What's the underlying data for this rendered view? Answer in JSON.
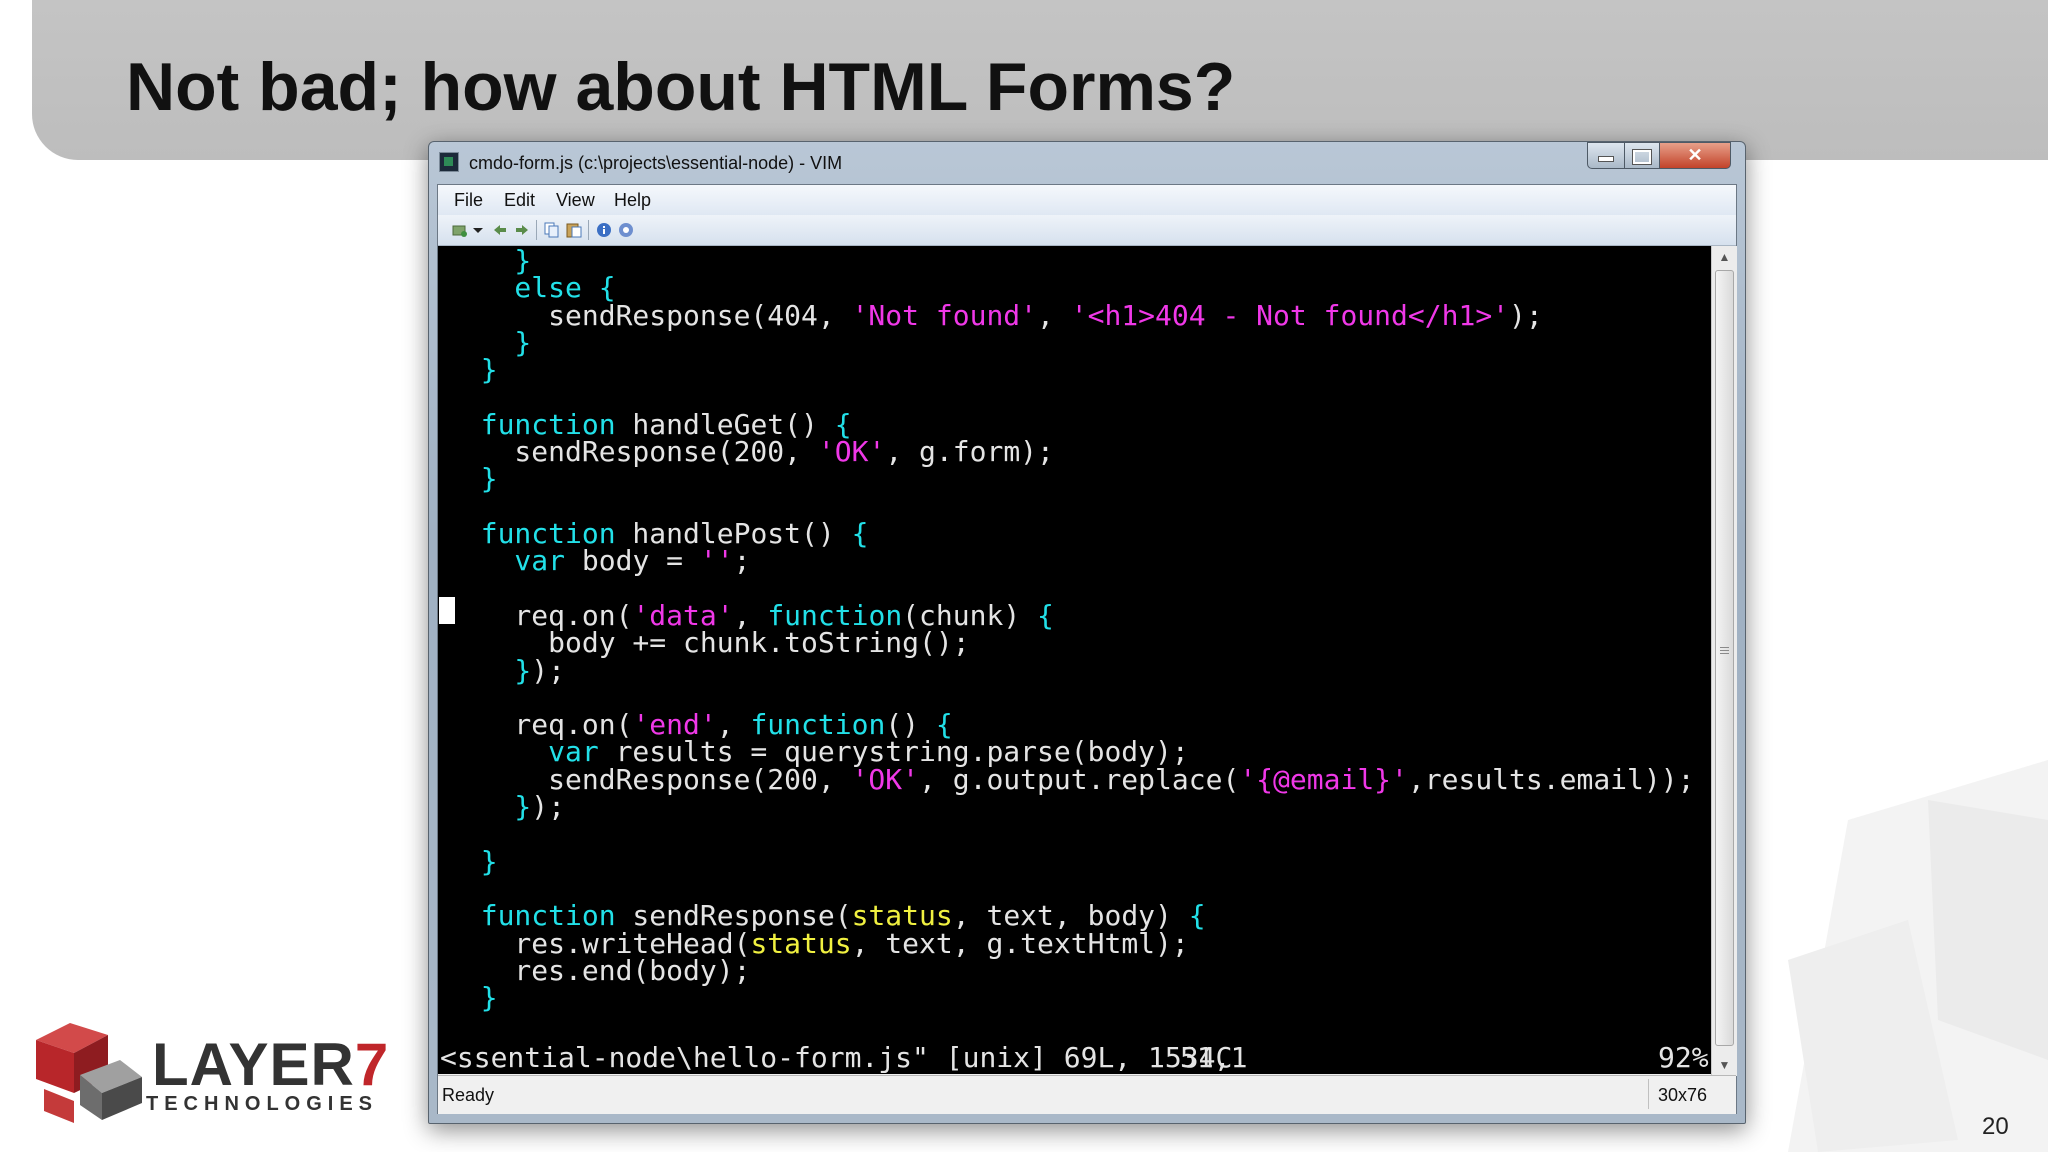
{
  "slide": {
    "title": "Not bad; how about HTML Forms?",
    "page_number": "20",
    "logo_text": "LAYER",
    "logo_number": "7",
    "logo_subtitle": "TECHNOLOGIES"
  },
  "window": {
    "title": "cmdo-form.js (c:\\projects\\essential-node) - VIM",
    "close_glyph": "✕"
  },
  "menu": [
    "File",
    "Edit",
    "View",
    "Help"
  ],
  "toolbar_icons": [
    "open-icon",
    "dropdown-arrow-icon",
    "back-icon",
    "forward-icon",
    "copy-icon",
    "paste-icon",
    "info-icon",
    "help-icon"
  ],
  "code_lines": [
    [
      {
        "c": "br",
        "t": "    }"
      }
    ],
    [
      {
        "c": "k",
        "t": "    else "
      },
      {
        "c": "br",
        "t": "{"
      }
    ],
    [
      {
        "c": "",
        "t": "      sendResponse(404, "
      },
      {
        "c": "s",
        "t": "'Not found'"
      },
      {
        "c": "",
        "t": ", "
      },
      {
        "c": "s",
        "t": "'<h1>404 - Not found</h1>'"
      },
      {
        "c": "",
        "t": ");"
      }
    ],
    [
      {
        "c": "br",
        "t": "    }"
      }
    ],
    [
      {
        "c": "br",
        "t": "  }"
      }
    ],
    [],
    [
      {
        "c": "k",
        "t": "  function"
      },
      {
        "c": "",
        "t": " handleGet() "
      },
      {
        "c": "br",
        "t": "{"
      }
    ],
    [
      {
        "c": "",
        "t": "    sendResponse(200, "
      },
      {
        "c": "s",
        "t": "'OK'"
      },
      {
        "c": "",
        "t": ", g.form);"
      }
    ],
    [
      {
        "c": "br",
        "t": "  }"
      }
    ],
    [],
    [
      {
        "c": "k",
        "t": "  function"
      },
      {
        "c": "",
        "t": " handlePost() "
      },
      {
        "c": "br",
        "t": "{"
      }
    ],
    [
      {
        "c": "k",
        "t": "    var"
      },
      {
        "c": "",
        "t": " body = "
      },
      {
        "c": "s",
        "t": "''"
      },
      {
        "c": "",
        "t": ";"
      }
    ],
    [],
    [
      {
        "c": "",
        "t": "    req.on("
      },
      {
        "c": "s",
        "t": "'data'"
      },
      {
        "c": "",
        "t": ", "
      },
      {
        "c": "k",
        "t": "function"
      },
      {
        "c": "",
        "t": "(chunk) "
      },
      {
        "c": "br",
        "t": "{"
      }
    ],
    [
      {
        "c": "",
        "t": "      body += chunk.toString();"
      }
    ],
    [
      {
        "c": "br",
        "t": "    }"
      },
      {
        "c": "",
        "t": ");"
      }
    ],
    [],
    [
      {
        "c": "",
        "t": "    req.on("
      },
      {
        "c": "s",
        "t": "'end'"
      },
      {
        "c": "",
        "t": ", "
      },
      {
        "c": "k",
        "t": "function"
      },
      {
        "c": "",
        "t": "() "
      },
      {
        "c": "br",
        "t": "{"
      }
    ],
    [
      {
        "c": "k",
        "t": "      var"
      },
      {
        "c": "",
        "t": " results = querystring.parse(body);"
      }
    ],
    [
      {
        "c": "",
        "t": "      sendResponse(200, "
      },
      {
        "c": "s",
        "t": "'OK'"
      },
      {
        "c": "",
        "t": ", g.output.replace("
      },
      {
        "c": "s",
        "t": "'{@email}'"
      },
      {
        "c": "",
        "t": ",results.email));"
      }
    ],
    [
      {
        "c": "br",
        "t": "    }"
      },
      {
        "c": "",
        "t": ");"
      }
    ],
    [],
    [
      {
        "c": "br",
        "t": "  }"
      }
    ],
    [],
    [
      {
        "c": "k",
        "t": "  function"
      },
      {
        "c": "",
        "t": " sendResponse("
      },
      {
        "c": "y",
        "t": "status"
      },
      {
        "c": "",
        "t": ", text, body) "
      },
      {
        "c": "br",
        "t": "{"
      }
    ],
    [
      {
        "c": "",
        "t": "    res.writeHead("
      },
      {
        "c": "y",
        "t": "status"
      },
      {
        "c": "",
        "t": ", text, g.textHtml);"
      }
    ],
    [
      {
        "c": "",
        "t": "    res.end(body);"
      }
    ],
    [
      {
        "c": "br",
        "t": "  }"
      }
    ]
  ],
  "vim_status": {
    "file_info": "<ssential-node\\hello-form.js\" [unix] 69L, 1534C",
    "position": "51,1",
    "percent": "92%"
  },
  "statusbar": {
    "ready": "Ready",
    "dimensions": "30x76"
  },
  "colors": {
    "keyword": "#22e0e8",
    "string": "#f038e8",
    "param_highlight": "#f0f040",
    "editor_bg": "#000000"
  }
}
